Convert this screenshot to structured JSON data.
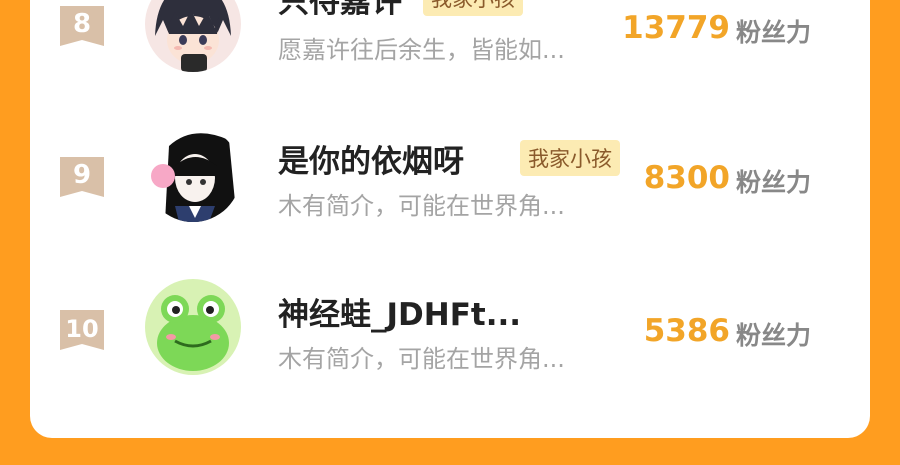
{
  "theme": {
    "background": "#FF9D1F",
    "card": "#FFFFFF",
    "score_color": "#F2A528",
    "badge_color": "#D9C0A8",
    "tag_bg": "#FCEBB3"
  },
  "leaderboard": {
    "entries": [
      {
        "rank": "8",
        "name": "只待嘉许",
        "tag": "我家小孩",
        "bio": "愿嘉许往后余生，皆能如...",
        "score": "13779",
        "unit": "粉丝力",
        "avatar_icon": "anime-boy-avatar-icon"
      },
      {
        "rank": "9",
        "name": "是你的依烟呀",
        "tag": "我家小孩",
        "bio": "木有简介，可能在世界角...",
        "score": "8300",
        "unit": "粉丝力",
        "avatar_icon": "anime-girl-bubblegum-avatar-icon"
      },
      {
        "rank": "10",
        "name": "神经蛙_JDHFt...",
        "tag": "",
        "bio": "木有简介，可能在世界角...",
        "score": "5386",
        "unit": "粉丝力",
        "avatar_icon": "frog-avatar-icon"
      }
    ]
  }
}
